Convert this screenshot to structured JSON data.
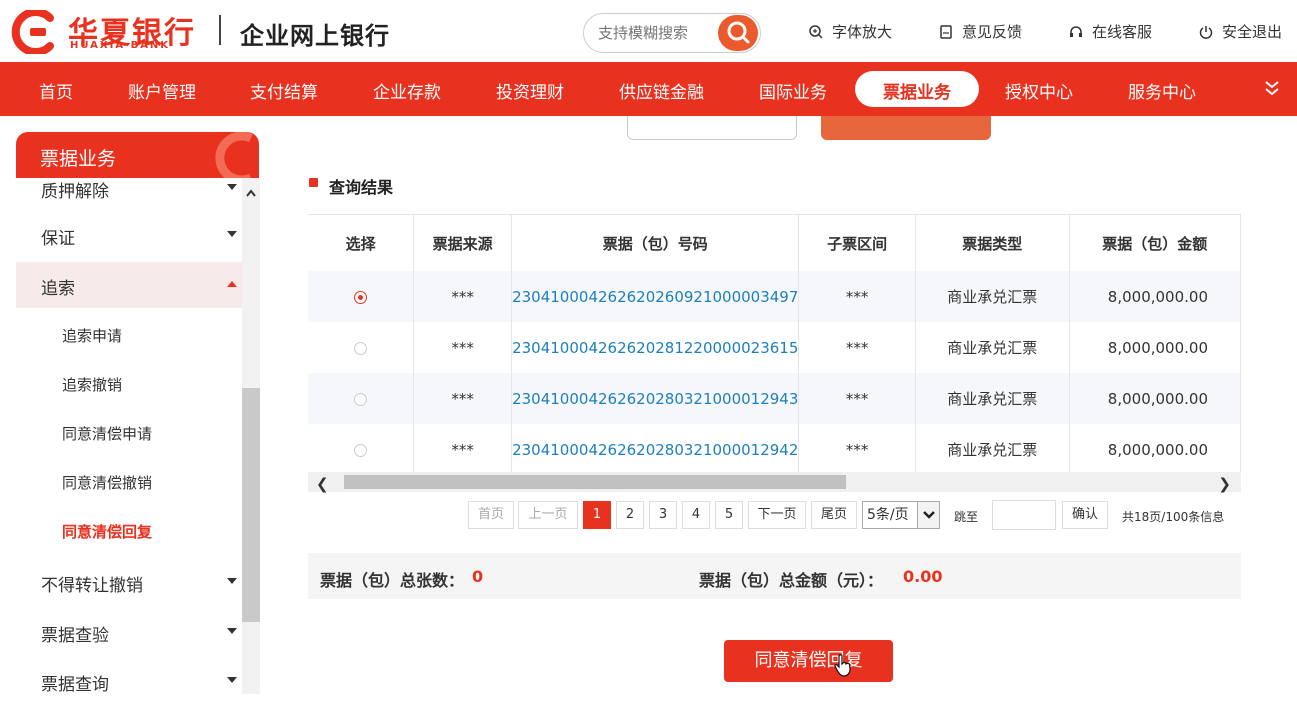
{
  "brand": {
    "name_cn": "华夏银行",
    "name_en": "HUAXIA BANK",
    "subtitle": "企业网上银行"
  },
  "search": {
    "placeholder": "支持模糊搜索"
  },
  "top_links": [
    {
      "label": "字体放大",
      "icon": "zoom-icon"
    },
    {
      "label": "意见反馈",
      "icon": "feedback-icon"
    },
    {
      "label": "在线客服",
      "icon": "headset-icon"
    },
    {
      "label": "安全退出",
      "icon": "power-icon"
    }
  ],
  "nav": {
    "items": [
      "首页",
      "账户管理",
      "支付结算",
      "企业存款",
      "投资理财",
      "供应链金融",
      "国际业务",
      "票据业务",
      "授权中心",
      "服务中心"
    ],
    "active": "票据业务"
  },
  "sidebar": {
    "title": "票据业务",
    "items": [
      {
        "label": "质押解除",
        "expanded": false
      },
      {
        "label": "保证",
        "expanded": false
      },
      {
        "label": "追索",
        "expanded": true
      },
      {
        "label": "不得转让撤销",
        "expanded": false
      },
      {
        "label": "票据查验",
        "expanded": false
      },
      {
        "label": "票据查询",
        "expanded": false
      }
    ],
    "sub_items": [
      "追索申请",
      "追索撤销",
      "同意清偿申请",
      "同意清偿撤销",
      "同意清偿回复"
    ],
    "active_sub": "同意清偿回复"
  },
  "section_title": "查询结果",
  "table": {
    "headers": [
      "选择",
      "票据来源",
      "票据（包）号码",
      "子票区间",
      "票据类型",
      "票据（包）金额"
    ],
    "rows": [
      {
        "selected": true,
        "source": "***",
        "number": "230410004262620260921000003497",
        "range": "***",
        "type": "商业承兑汇票",
        "amount": "8,000,000.00"
      },
      {
        "selected": false,
        "source": "***",
        "number": "230410004262620281220000023615",
        "range": "***",
        "type": "商业承兑汇票",
        "amount": "8,000,000.00"
      },
      {
        "selected": false,
        "source": "***",
        "number": "230410004262620280321000012943",
        "range": "***",
        "type": "商业承兑汇票",
        "amount": "8,000,000.00"
      },
      {
        "selected": false,
        "source": "***",
        "number": "230410004262620280321000012942",
        "range": "***",
        "type": "商业承兑汇票",
        "amount": "8,000,000.00"
      }
    ]
  },
  "pagination": {
    "first": "首页",
    "prev": "上一页",
    "pages": [
      "1",
      "2",
      "3",
      "4",
      "5"
    ],
    "current": "1",
    "next": "下一页",
    "last": "尾页",
    "page_size": "5条/页",
    "goto_label": "跳至",
    "confirm": "确认",
    "info": "共18页/100条信息"
  },
  "summary": {
    "count_label": "票据（包）总张数：",
    "count_value": "0",
    "amount_label": "票据（包）总金额（元）：",
    "amount_value": "0.00"
  },
  "submit_label": "同意清偿回复",
  "colors": {
    "brand_red": "#e8311e",
    "link_blue": "#1d7fbc"
  }
}
